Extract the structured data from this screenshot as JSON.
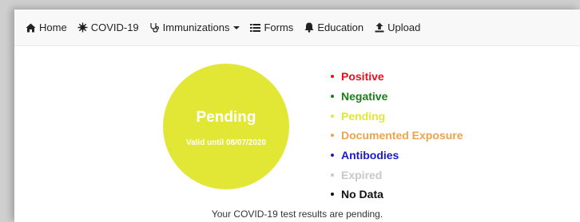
{
  "nav": {
    "items": [
      {
        "label": "Home",
        "icon": "home-icon"
      },
      {
        "label": "COVID-19",
        "icon": "virus-icon"
      },
      {
        "label": "Immunizations",
        "icon": "stethoscope-icon",
        "dropdown": true
      },
      {
        "label": "Forms",
        "icon": "list-icon"
      },
      {
        "label": "Education",
        "icon": "bell-icon"
      },
      {
        "label": "Upload",
        "icon": "upload-icon"
      }
    ]
  },
  "status": {
    "title": "Pending",
    "valid_until": "Valid until 08/07/2020",
    "color": "#e2e735",
    "message": "Your COVID-19 test results are pending."
  },
  "legend": [
    {
      "label": "Positive",
      "color": "#e8101e"
    },
    {
      "label": "Negative",
      "color": "#1a7d1a"
    },
    {
      "label": "Pending",
      "color": "#e2e735"
    },
    {
      "label": "Documented Exposure",
      "color": "#eba34d"
    },
    {
      "label": "Antibodies",
      "color": "#1a1acc"
    },
    {
      "label": "Expired",
      "color": "#c8c8c8"
    },
    {
      "label": "No Data",
      "color": "#111111"
    }
  ]
}
